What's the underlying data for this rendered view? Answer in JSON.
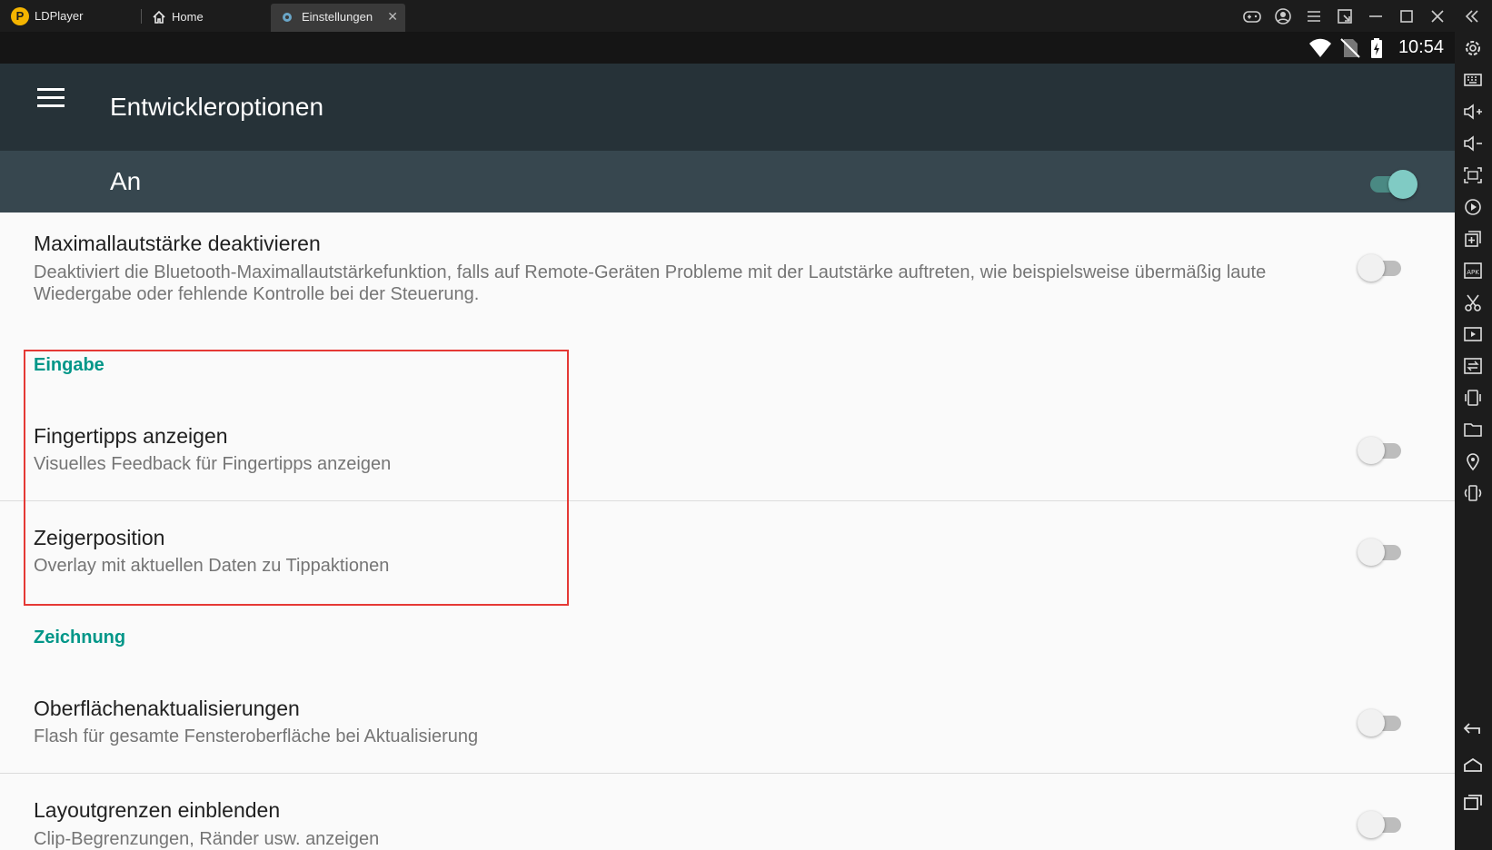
{
  "window": {
    "app_name": "LDPlayer",
    "logo_letter": "P",
    "tabs": [
      {
        "label": "Home",
        "icon": "home-icon"
      },
      {
        "label": "Einstellungen",
        "icon": "settings-gear-icon"
      }
    ],
    "controls": [
      "gamepad-icon",
      "account-icon",
      "menu-icon",
      "shrink-window-icon",
      "minimize-icon",
      "maximize-icon",
      "close-icon",
      "collapse-sidebar-icon"
    ]
  },
  "statusbar": {
    "time": "10:54",
    "icons": [
      "wifi-icon",
      "no-sim-icon",
      "battery-charging-icon"
    ]
  },
  "sidebar": {
    "icons": [
      "settings-icon",
      "keyboard-icon",
      "volume-up-icon",
      "volume-down-icon",
      "screenshot-icon",
      "record-icon",
      "add-app-icon",
      "apk-install-icon",
      "scissors-icon",
      "video-play-icon",
      "sync-icon",
      "shake-icon",
      "folder-icon",
      "location-icon",
      "rotate-icon"
    ],
    "nav": [
      "back-icon",
      "home-icon",
      "recents-icon"
    ]
  },
  "appbar": {
    "title": "Entwickleroptionen"
  },
  "master": {
    "label": "An",
    "on": true
  },
  "items": {
    "maxvol": {
      "title": "Maximallautstärke deaktivieren",
      "summary": "Deaktiviert die Bluetooth-Maximallautstärkefunktion, falls auf Remote-Geräten Probleme mit der Lautstärke auftreten, wie beispielsweise übermäßig laute Wiedergabe oder fehlende Kontrolle bei der Steuerung."
    },
    "input_header": "Eingabe",
    "touches": {
      "title": "Fingertipps anzeigen",
      "summary": "Visuelles Feedback für Fingertipps anzeigen"
    },
    "pointer": {
      "title": "Zeigerposition",
      "summary": "Overlay mit aktuellen Daten zu Tippaktionen"
    },
    "drawing_header": "Zeichnung",
    "surface": {
      "title": "Oberflächenaktualisierungen",
      "summary": "Flash für gesamte Fensteroberfläche bei Aktualisierung"
    },
    "layout": {
      "title": "Layoutgrenzen einblenden",
      "summary": "Clip-Begrenzungen, Ränder usw. anzeigen"
    }
  },
  "colors": {
    "appbar": "#263238",
    "masterbar": "#37474f",
    "accent": "#009688",
    "switch_on": "#80cbc4",
    "highlight_box": "#e53935"
  }
}
